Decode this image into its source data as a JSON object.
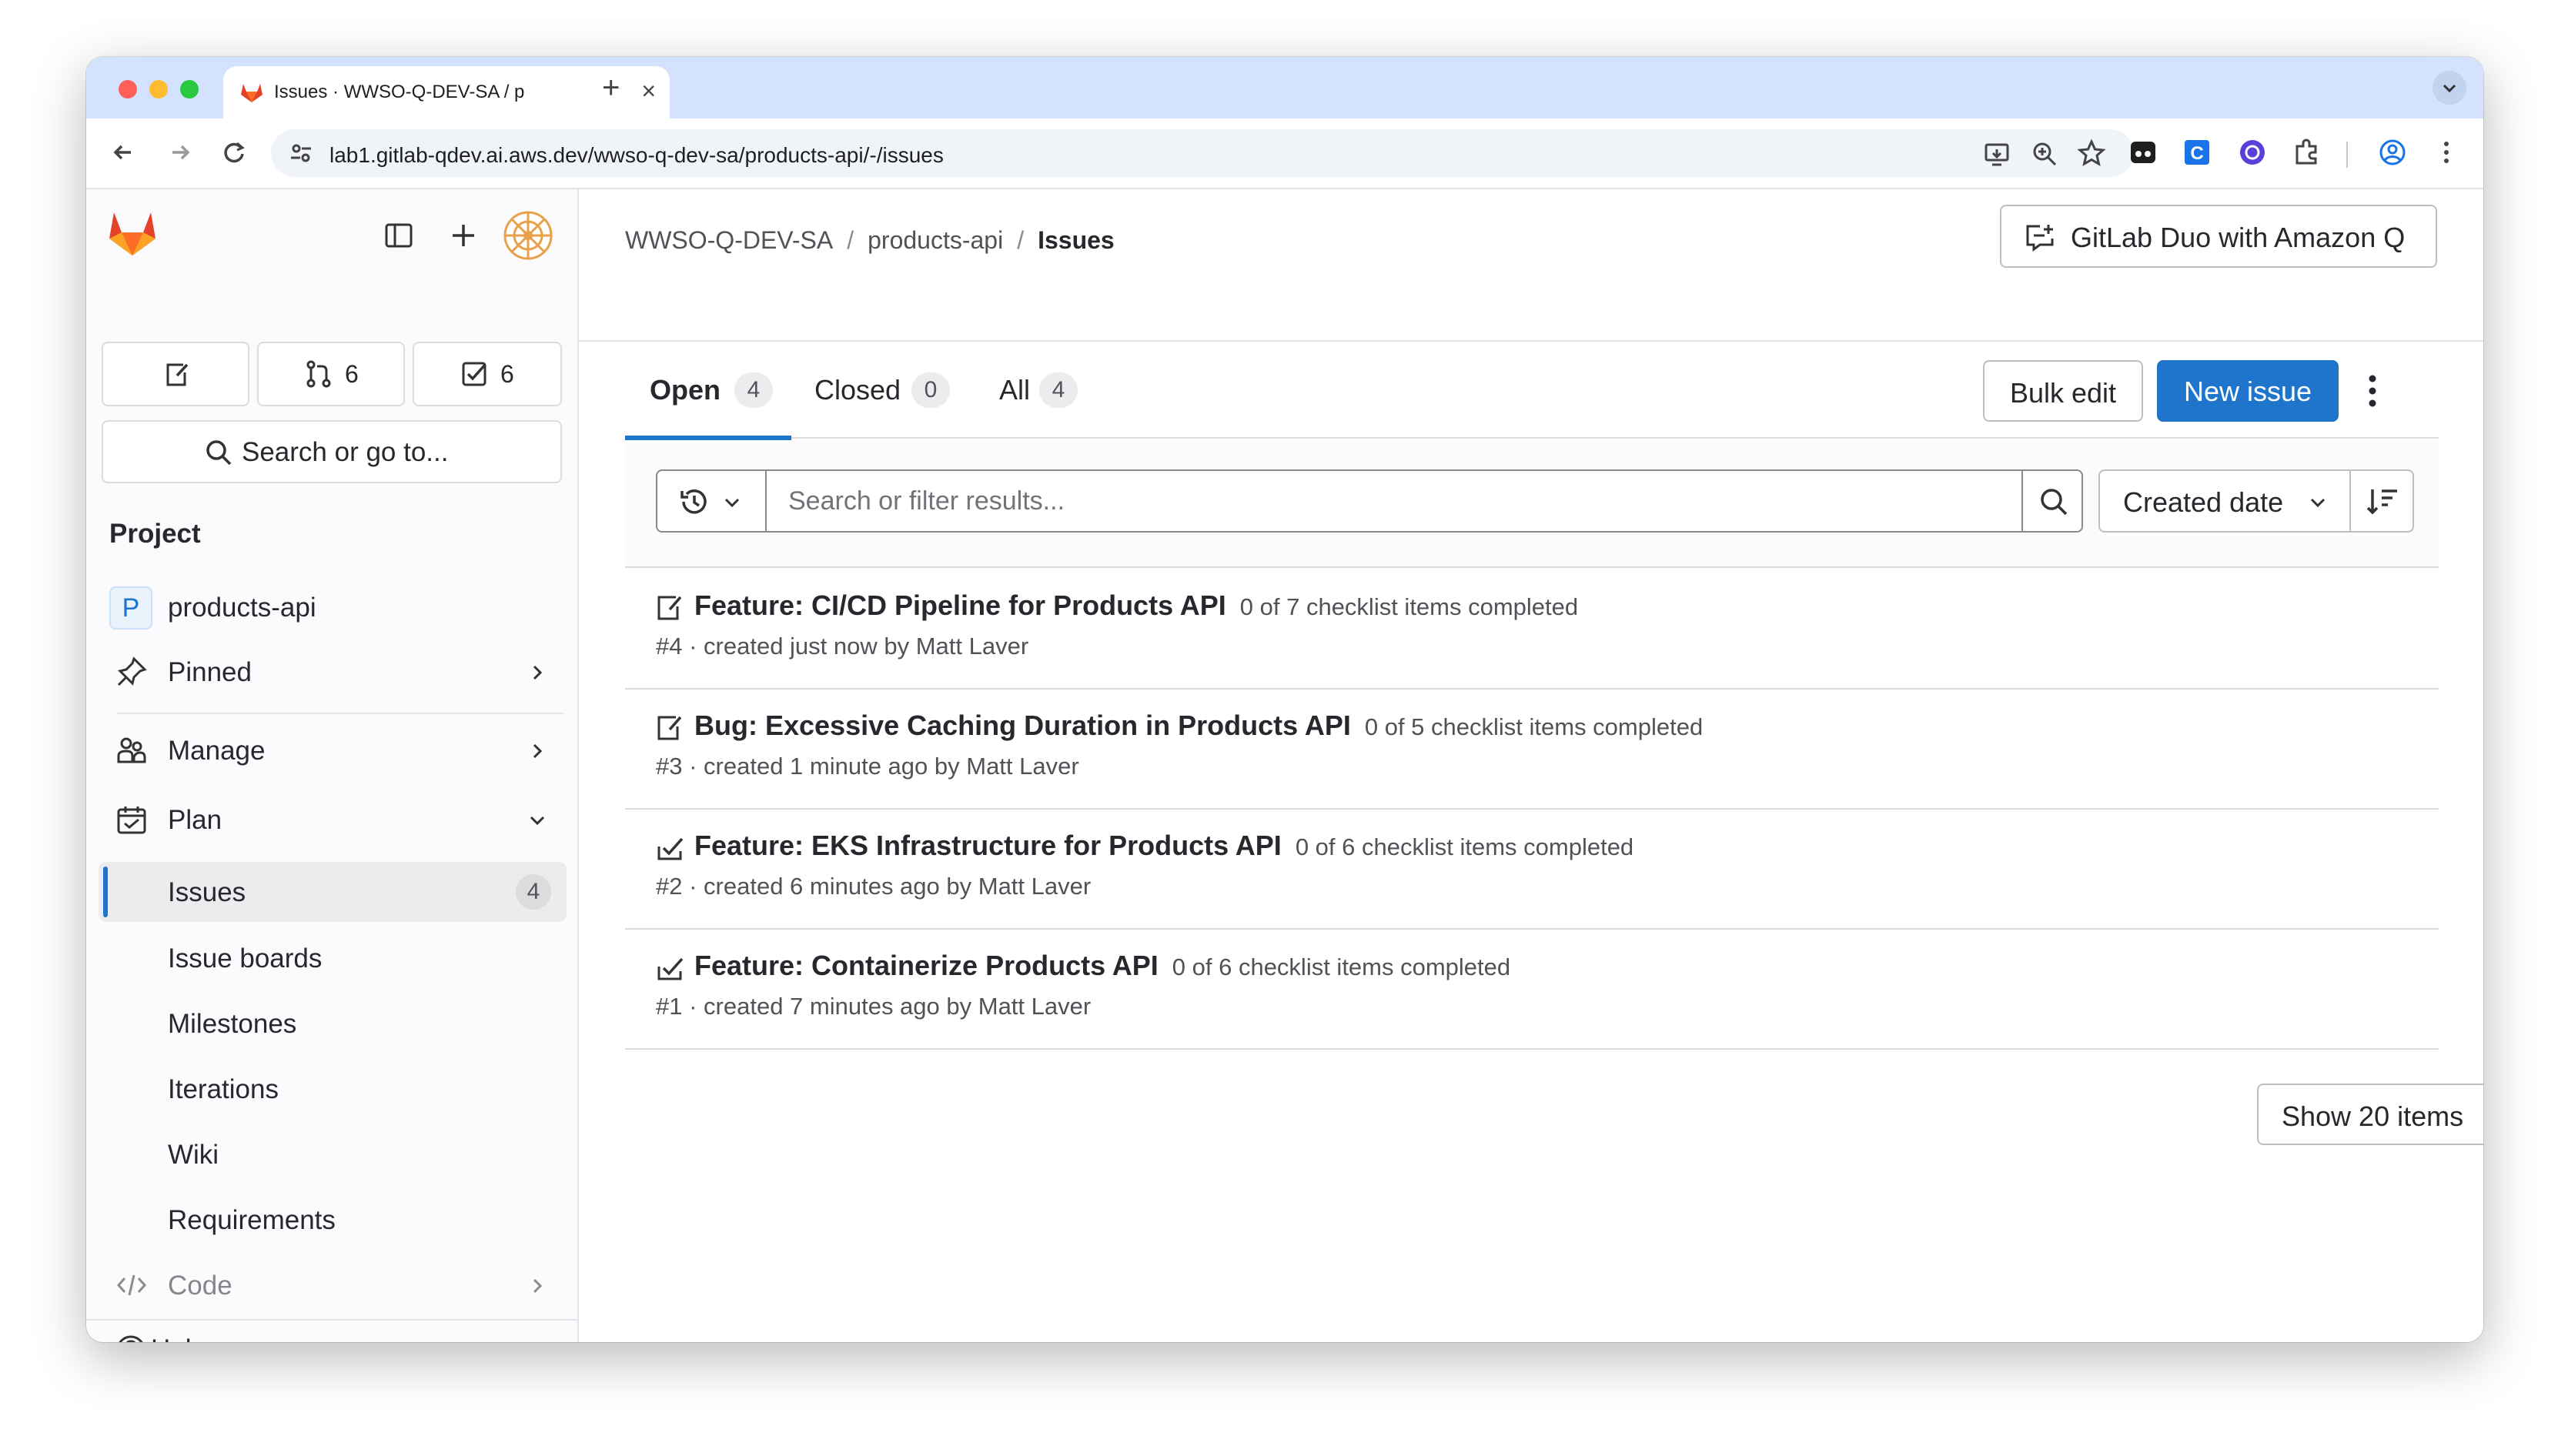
{
  "browser": {
    "tab_title": "Issues · WWSO-Q-DEV-SA / p",
    "url": "lab1.gitlab-qdev.ai.aws.dev/wwso-q-dev-sa/products-api/-/issues"
  },
  "sidebar": {
    "merge_requests_count": "6",
    "todos_count": "6",
    "search_label": "Search or go to...",
    "section_title": "Project",
    "project_avatar_letter": "P",
    "project_name": "products-api",
    "items": {
      "pinned": "Pinned",
      "manage": "Manage",
      "plan": "Plan",
      "issues": "Issues",
      "issues_count": "4",
      "issue_boards": "Issue boards",
      "milestones": "Milestones",
      "iterations": "Iterations",
      "wiki": "Wiki",
      "requirements": "Requirements",
      "code": "Code"
    },
    "help": "Help"
  },
  "header": {
    "breadcrumb": [
      "WWSO-Q-DEV-SA",
      "products-api",
      "Issues"
    ],
    "duo_button": "GitLab Duo with Amazon Q"
  },
  "tabs": [
    {
      "label": "Open",
      "count": "4"
    },
    {
      "label": "Closed",
      "count": "0"
    },
    {
      "label": "All",
      "count": "4"
    }
  ],
  "actions": {
    "bulk_edit": "Bulk edit",
    "new_issue": "New issue"
  },
  "filter": {
    "placeholder": "Search or filter results...",
    "sort_label": "Created date"
  },
  "issues": [
    {
      "title": "Feature: CI/CD Pipeline for Products API",
      "checklist": "0 of 7 checklist items completed",
      "meta": "#4 · created just now by Matt Laver",
      "icon": "issue-open-icon"
    },
    {
      "title": "Bug: Excessive Caching Duration in Products API",
      "checklist": "0 of 5 checklist items completed",
      "meta": "#3 · created 1 minute ago by Matt Laver",
      "icon": "issue-open-icon"
    },
    {
      "title": "Feature: EKS Infrastructure for Products API",
      "checklist": "0 of 6 checklist items completed",
      "meta": "#2 · created 6 minutes ago by Matt Laver",
      "icon": "task-icon"
    },
    {
      "title": "Feature: Containerize Products API",
      "checklist": "0 of 6 checklist items completed",
      "meta": "#1 · created 7 minutes ago by Matt Laver",
      "icon": "task-icon"
    }
  ],
  "pagination": {
    "show_items": "Show 20 items"
  },
  "colors": {
    "accent": "#1f75cb",
    "tab_strip": "#d3e3fd",
    "gitlab_orange": "#e24329"
  }
}
